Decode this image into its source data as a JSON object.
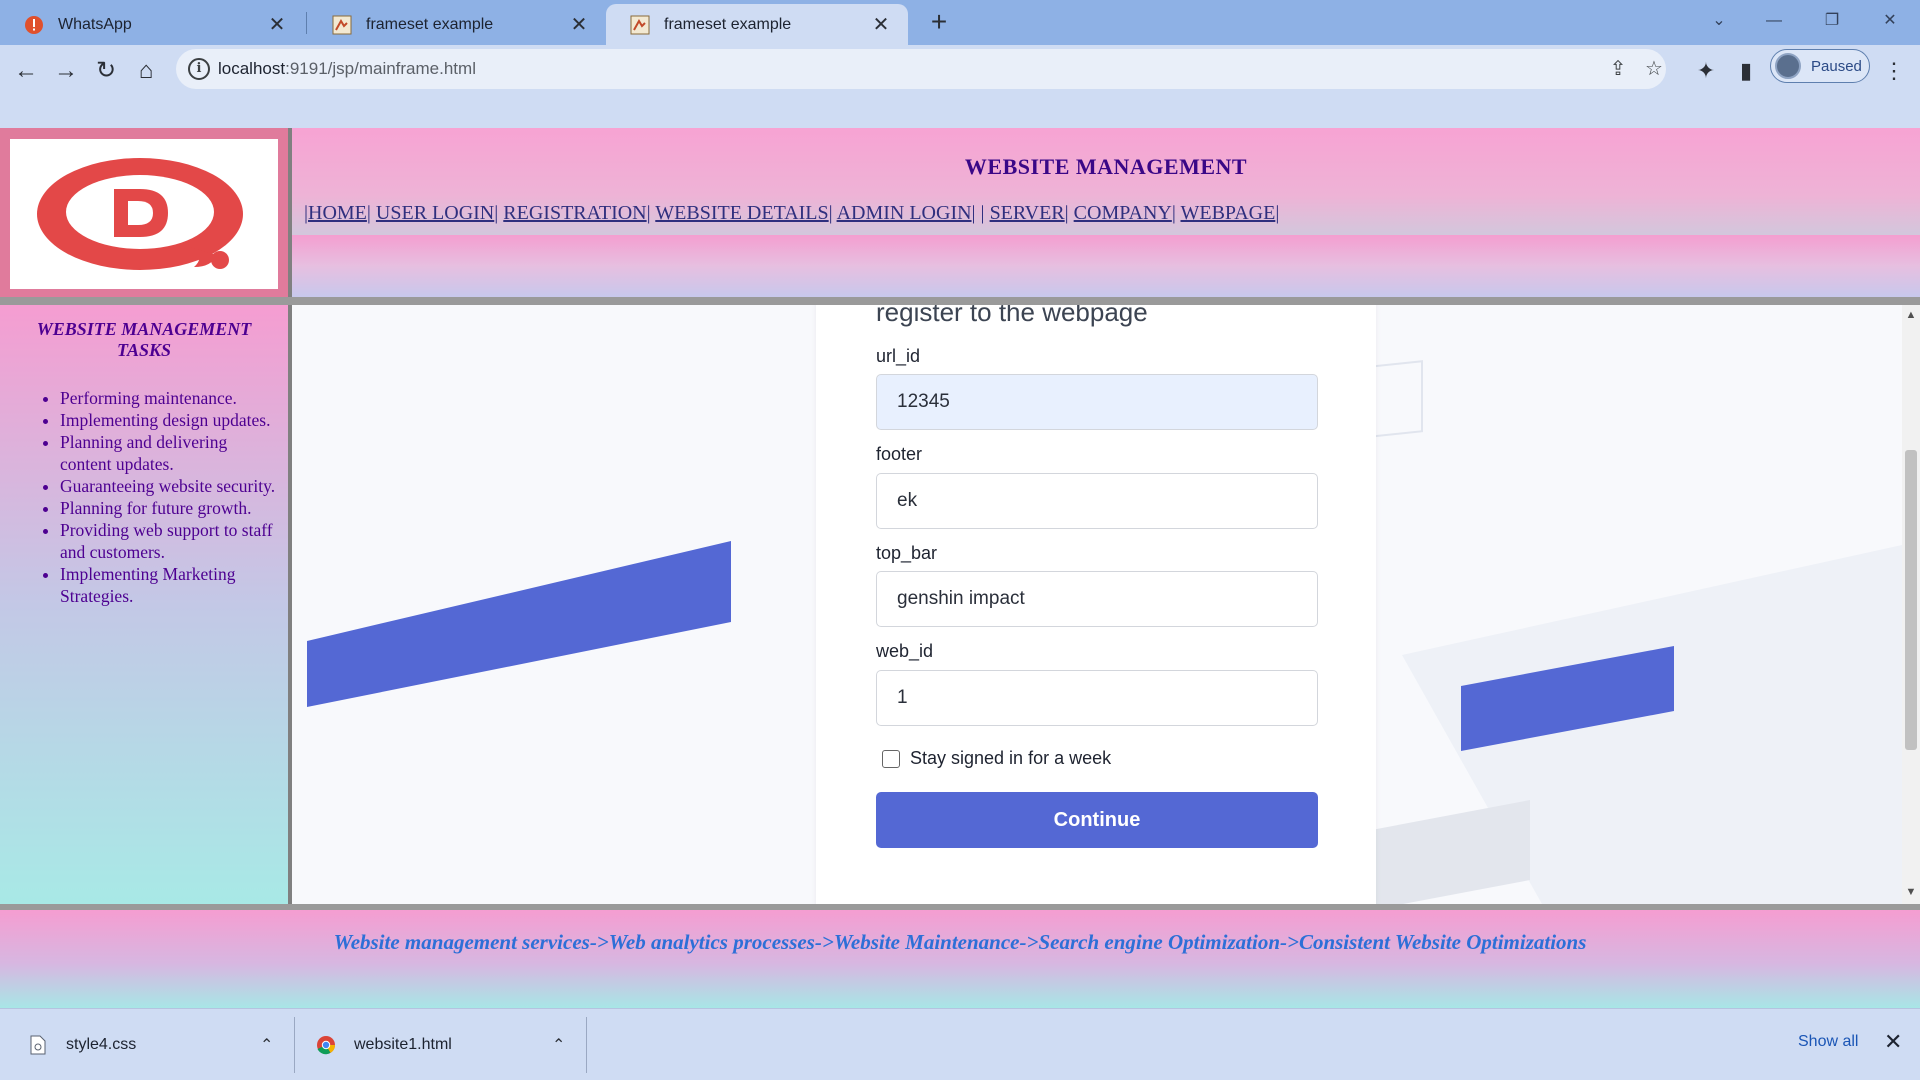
{
  "browser": {
    "tabs": [
      {
        "title": "WhatsApp",
        "icon": "whatsapp-alert-icon"
      },
      {
        "title": "frameset example",
        "icon": "page-favicon"
      },
      {
        "title": "frameset example",
        "icon": "page-favicon",
        "active": true
      }
    ],
    "url_host": "localhost",
    "url_rest": ":9191/jsp/mainframe.html",
    "profile_label": "Paused"
  },
  "header": {
    "title": "WEBSITE MANAGEMENT",
    "nav": [
      "HOME",
      "USER LOGIN",
      "REGISTRATION",
      "WEBSITE DETAILS",
      "ADMIN LOGIN",
      "SERVER",
      "COMPANY",
      "WEBPAGE"
    ]
  },
  "sidebar": {
    "title": "WEBSITE MANAGEMENT TASKS",
    "items": [
      "Performing maintenance.",
      "Implementing design updates.",
      "Planning and delivering content updates.",
      "Guaranteeing website security.",
      "Planning for future growth.",
      "Providing web support to staff and customers.",
      "Implementing Marketing Strategies."
    ]
  },
  "form": {
    "heading": "register to the webpage",
    "fields": [
      {
        "label": "url_id",
        "value": "12345"
      },
      {
        "label": "footer",
        "value": "ek"
      },
      {
        "label": "top_bar",
        "value": "genshin impact"
      },
      {
        "label": "web_id",
        "value": "1"
      }
    ],
    "remember_label": "Stay signed in for a week",
    "submit_label": "Continue"
  },
  "footer": {
    "text": "Website management services->Web analytics processes->Website Maintenance->Search engine Optimization->Consistent Website Optimizations"
  },
  "downloads": {
    "items": [
      "style4.css",
      "website1.html"
    ],
    "show_all": "Show all"
  },
  "colors": {
    "accent_blue": "#5468d4",
    "header_title": "#3a0787",
    "footer_text": "#2d6fd7",
    "logo_red": "#e34848"
  }
}
